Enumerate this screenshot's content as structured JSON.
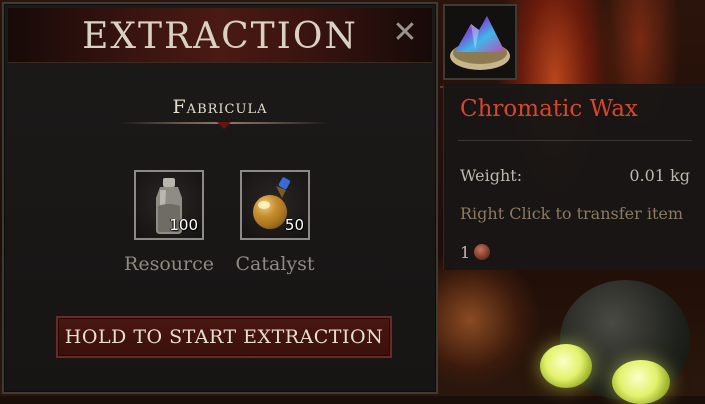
{
  "extraction_panel": {
    "title": "EXTRACTION",
    "close_icon": "close-icon",
    "section_label": "Fabricula",
    "slots": [
      {
        "name": "resource",
        "quantity": "100",
        "caption": "Resource",
        "icon": "bottle-icon"
      },
      {
        "name": "catalyst",
        "quantity": "50",
        "caption": "Catalyst",
        "icon": "potion-flask-icon"
      }
    ],
    "start_button_label": "HOLD TO START EXTRACTION"
  },
  "tooltip": {
    "item_icon": "chromatic-wax-icon",
    "item_name": "Chromatic Wax",
    "weight_label": "Weight:",
    "weight_value": "0.01 kg",
    "hint": "Right Click to transfer item",
    "count": "1",
    "count_icon": "coin-icon"
  },
  "colors": {
    "item_name": "#d8452d",
    "button_bg": "#4a1611",
    "header_bg": "#3a1410"
  }
}
